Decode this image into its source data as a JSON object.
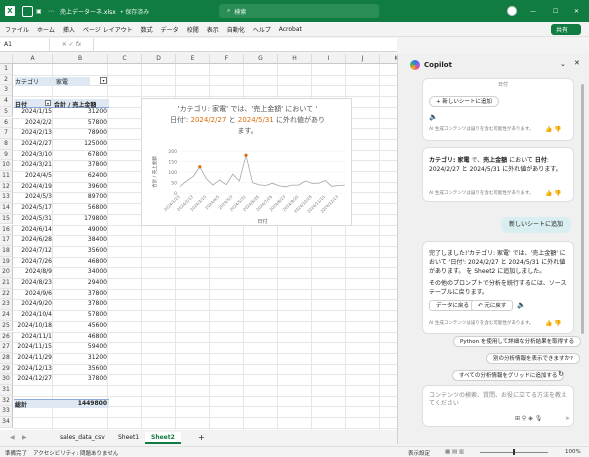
{
  "titlebar": {
    "filename": "売上データーネ.xlsx",
    "saved": "• 保存済み",
    "search": "検索",
    "autosave": "オフ"
  },
  "ribbon": {
    "tabs": [
      "ファイル",
      "ホーム",
      "挿入",
      "ページ レイアウト",
      "数式",
      "データ",
      "校閲",
      "表示",
      "自動化",
      "ヘルプ",
      "Acrobat"
    ],
    "share": "共有"
  },
  "formula": {
    "namebox": "A1",
    "fx": "fx"
  },
  "columns": [
    "A",
    "B",
    "C",
    "D",
    "E",
    "F",
    "G",
    "H",
    "I",
    "J",
    "K"
  ],
  "sheet": {
    "filter_label": "カテゴリ",
    "filter_value": "家電",
    "hdr_date": "日付",
    "hdr_total": "合計 / 売上金額",
    "rows": [
      [
        "2024/1/15",
        "31200"
      ],
      [
        "2024/2/2",
        "57800"
      ],
      [
        "2024/2/13",
        "78900"
      ],
      [
        "2024/2/27",
        "125000"
      ],
      [
        "2024/3/10",
        "67800"
      ],
      [
        "2024/3/21",
        "37800"
      ],
      [
        "2024/4/5",
        "62400"
      ],
      [
        "2024/4/19",
        "39600"
      ],
      [
        "2024/5/3",
        "89700"
      ],
      [
        "2024/5/17",
        "56800"
      ],
      [
        "2024/5/31",
        "179800"
      ],
      [
        "2024/6/14",
        "49000"
      ],
      [
        "2024/6/28",
        "38400"
      ],
      [
        "2024/7/12",
        "35600"
      ],
      [
        "2024/7/26",
        "46800"
      ],
      [
        "2024/8/9",
        "34000"
      ],
      [
        "2024/8/23",
        "29400"
      ],
      [
        "2024/9/6",
        "37800"
      ],
      [
        "2024/9/20",
        "37800"
      ],
      [
        "2024/10/4",
        "57800"
      ],
      [
        "2024/10/18",
        "45600"
      ],
      [
        "2024/11/1",
        "46800"
      ],
      [
        "2024/11/15",
        "59400"
      ],
      [
        "2024/11/29",
        "31200"
      ],
      [
        "2024/12/13",
        "35600"
      ],
      [
        "2024/12/27",
        "37800"
      ]
    ],
    "total_label": "総計",
    "total_value": "1449800"
  },
  "chart_data": {
    "type": "line",
    "title_line1": "'カテゴリ: 家電' では、'売上金額' において '",
    "title_line2_a": "日付': ",
    "title_date1": "2024/2/27",
    "title_mid": " と ",
    "title_date2": "2024/5/31",
    "title_end": " に外れ値があり",
    "title_line3": "ます。",
    "xlabel": "日付",
    "ylabel": "合計 / 売上金額",
    "yticks": [
      "200",
      "150",
      "100",
      "50",
      "0"
    ],
    "ylim": [
      0,
      200
    ],
    "x": [
      "2024/1/15",
      "2024/2/2",
      "2024/2/13",
      "2024/2/27",
      "2024/3/10",
      "2024/3/21",
      "2024/4/5",
      "2024/4/19",
      "2024/5/3",
      "2024/5/17",
      "2024/5/31",
      "2024/6/14",
      "2024/6/28",
      "2024/7/12",
      "2024/7/26",
      "2024/8/9",
      "2024/8/23",
      "2024/9/6",
      "2024/9/20",
      "2024/10/4",
      "2024/10/18",
      "2024/11/1",
      "2024/11/15",
      "2024/11/29",
      "2024/12/13",
      "2024/12/27"
    ],
    "values": [
      31.2,
      57.8,
      78.9,
      125,
      67.8,
      37.8,
      62.4,
      39.6,
      89.7,
      56.8,
      179.8,
      49,
      38.4,
      35.6,
      46.8,
      34,
      29.4,
      37.8,
      37.8,
      57.8,
      45.6,
      46.8,
      59.4,
      31.2,
      35.6,
      37.8
    ],
    "xticks": [
      "2024/1/15",
      "2024/2/13",
      "2024/3/10",
      "2024/4/5",
      "2024/5/3",
      "2024/5/31",
      "2024/6/28",
      "2024/7/26",
      "2024/8/23",
      "2024/9/20",
      "2024/10/18",
      "2024/11/15",
      "2024/12/13"
    ],
    "outliers": [
      3,
      10
    ],
    "line_color": "#a6a6a6",
    "outlier_color": "#d86d0b"
  },
  "tabs": {
    "t1": "sales_data_csv",
    "t2": "Sheet1",
    "t3": "Sheet2",
    "add": "+"
  },
  "status": {
    "ready": "準備完了",
    "access": "アクセシビリティ: 問題ありません",
    "view": "表示設定",
    "zoom": "100%"
  },
  "copilot": {
    "title": "Copilot",
    "c1_axis": "日付",
    "c1_add": "新しいシートに追加",
    "c1_note": "AI 生成コンテンツは誤りを含む可能性があります。",
    "c2_a": "カテゴリ: 家電",
    "c2_b": " で、",
    "c2_c": "売上金額",
    "c2_d": " において ",
    "c2_e": "日付",
    "c2_f": ":",
    "c2_line2": "2024/2/27 と 2024/5/31 に外れ値があります。",
    "c2_note": "AI 生成コンテンツは誤りを含む可能性があります。",
    "user_msg": "新しいシートに追加",
    "c3_p1": "完了しました!'カテゴリ: 家電' では、'売上金額' において '日付': 2024/2/27 と 2024/5/31 に外れ値があります。 を Sheet2 に追加しました。",
    "c3_p2": "その他のプロンプトで分析を続行するには、ソース テーブルに戻ります。",
    "c3_btn1": "データに戻る",
    "c3_btn2": "元に戻す",
    "c3_note": "AI 生成コンテンツは誤りを含む可能性があります。",
    "sug1": "Python を使用して詳細な分析結果を取得する",
    "sug2": "別の分析情報を表示できますか?",
    "sug3": "すべての分析情報をグリッドに追加する",
    "input_ph": "コンテンツの検索、質問、お役に立てる方法を教えてください"
  }
}
